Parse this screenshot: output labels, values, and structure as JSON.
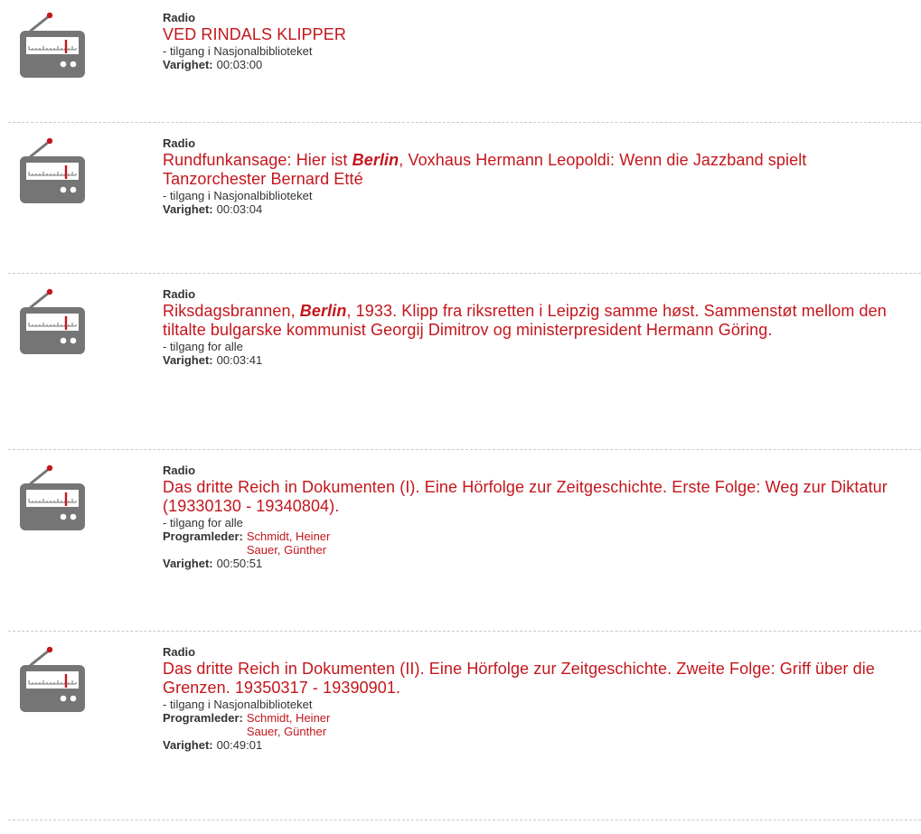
{
  "colors": {
    "link_red": "#c4161c",
    "text": "#333333",
    "icon_gray": "#757575",
    "divider": "#c9c9c9"
  },
  "results": [
    {
      "type": "Radio",
      "icon": "radio-icon",
      "title_parts": [
        {
          "text": "VED RINDALS KLIPPER",
          "bold": false
        }
      ],
      "access": "- tilgang i Nasjonalbiblioteket",
      "program_leader_label": "",
      "program_leaders": [],
      "duration_label": "Varighet:",
      "duration": "00:03:00"
    },
    {
      "type": "Radio",
      "icon": "radio-icon",
      "title_parts": [
        {
          "text": "Rundfunkansage: Hier ist ",
          "bold": false
        },
        {
          "text": "Berlin",
          "bold": true
        },
        {
          "text": ", Voxhaus Hermann Leopoldi: Wenn die Jazzband spielt Tanzorchester Bernard Etté",
          "bold": false
        }
      ],
      "access": "- tilgang i Nasjonalbiblioteket",
      "program_leader_label": "",
      "program_leaders": [],
      "duration_label": "Varighet:",
      "duration": "00:03:04"
    },
    {
      "type": "Radio",
      "icon": "radio-icon",
      "title_parts": [
        {
          "text": "Riksdagsbrannen, ",
          "bold": false
        },
        {
          "text": "Berlin",
          "bold": true
        },
        {
          "text": ", 1933. Klipp fra riksretten i Leipzig samme høst. Sammenstøt mellom den tiltalte bulgarske kommunist Georgij Dimitrov og ministerpresident Hermann Göring.",
          "bold": false
        }
      ],
      "access": "- tilgang for alle",
      "program_leader_label": "",
      "program_leaders": [],
      "duration_label": "Varighet:",
      "duration": "00:03:41"
    },
    {
      "type": "Radio",
      "icon": "radio-icon",
      "title_parts": [
        {
          "text": "Das dritte Reich in Dokumenten (I). Eine Hörfolge zur Zeitgeschichte. Erste Folge: Weg zur Diktatur (19330130 - 19340804).",
          "bold": false
        }
      ],
      "access": "- tilgang for alle",
      "program_leader_label": "Programleder:",
      "program_leaders": [
        "Schmidt, Heiner",
        "Sauer, Günther"
      ],
      "duration_label": "Varighet:",
      "duration": "00:50:51"
    },
    {
      "type": "Radio",
      "icon": "radio-icon",
      "title_parts": [
        {
          "text": "Das dritte Reich in Dokumenten (II). Eine Hörfolge zur Zeitgeschichte. Zweite Folge: Griff über die Grenzen. 19350317 - 19390901.",
          "bold": false
        }
      ],
      "access": "- tilgang i Nasjonalbiblioteket",
      "program_leader_label": "Programleder:",
      "program_leaders": [
        "Schmidt, Heiner",
        "Sauer, Günther"
      ],
      "duration_label": "Varighet:",
      "duration": "00:49:01"
    }
  ]
}
